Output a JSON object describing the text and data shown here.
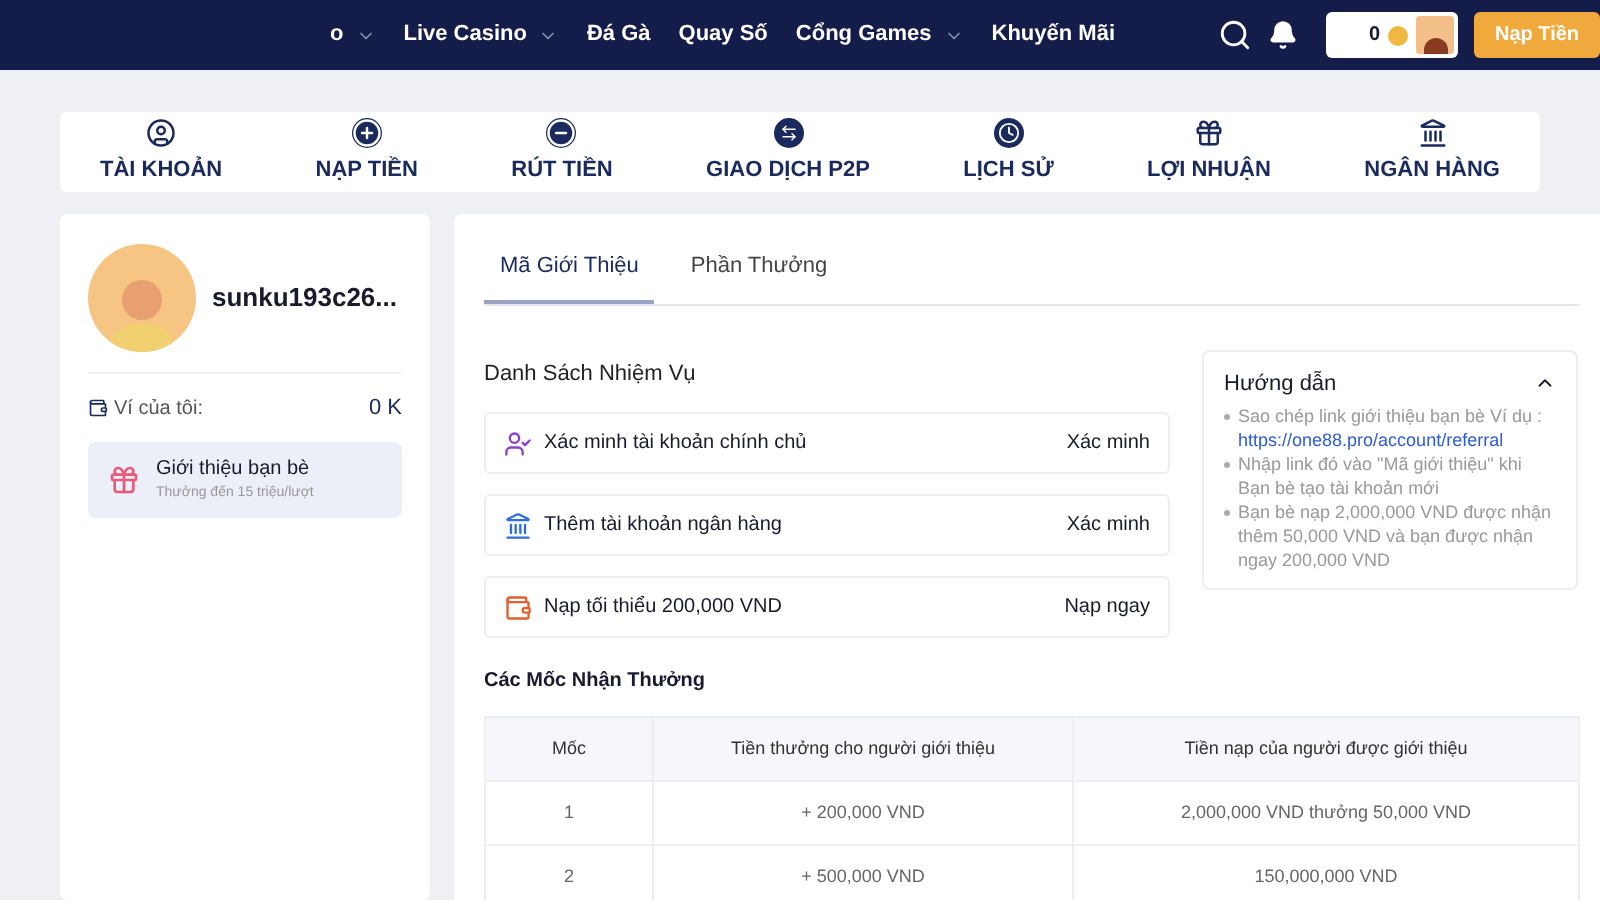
{
  "header": {
    "nav": [
      {
        "label": "o",
        "dropdown": true
      },
      {
        "label": "Live Casino",
        "dropdown": true
      },
      {
        "label": "Đá Gà",
        "dropdown": false
      },
      {
        "label": "Quay Số",
        "dropdown": false
      },
      {
        "label": "Cổng Games",
        "dropdown": true
      },
      {
        "label": "Khuyến Mãi",
        "dropdown": false
      }
    ],
    "balance": "0",
    "deposit_button": "Nạp Tiền"
  },
  "account_nav": [
    {
      "label": "TÀI KHOẢN",
      "kind": "user"
    },
    {
      "label": "NẠP TIỀN",
      "kind": "plus"
    },
    {
      "label": "RÚT TIỀN",
      "kind": "minus"
    },
    {
      "label": "GIAO DỊCH P2P",
      "kind": "swap"
    },
    {
      "label": "LỊCH SỬ",
      "kind": "clock"
    },
    {
      "label": "LỢI NHUẬN",
      "kind": "gift"
    },
    {
      "label": "NGÂN HÀNG",
      "kind": "bank"
    }
  ],
  "profile": {
    "username": "sunku193c26...",
    "wallet_label": "Ví của tôi:",
    "wallet_value": "0 K",
    "referral": {
      "title": "Giới thiệu bạn bè",
      "subtitle": "Thưởng đến 15 triệu/lượt"
    }
  },
  "tabs": [
    {
      "label": "Mã Giới Thiệu",
      "selected": true
    },
    {
      "label": "Phần Thưởng",
      "selected": false
    }
  ],
  "tasks": {
    "title": "Danh Sách Nhiệm Vụ",
    "items": [
      {
        "label": "Xác minh tài khoản chính chủ",
        "action": "Xác minh",
        "kind": "user"
      },
      {
        "label": "Thêm tài khoản ngân hàng",
        "action": "Xác minh",
        "kind": "bank"
      },
      {
        "label": "Nạp tối thiểu 200,000 VND",
        "action": "Nạp ngay",
        "kind": "wallet"
      }
    ]
  },
  "guide": {
    "title": "Hướng dẫn",
    "expanded": true,
    "items": [
      {
        "text": "Sao chép link giới thiệu bạn bè Ví dụ :",
        "link": "https://one88.pro/account/referral"
      },
      {
        "text": "Nhập link đó vào \"Mã giới thiệu\" khi Bạn bè tạo tài khoản mới"
      },
      {
        "text": "Bạn bè nạp 2,000,000 VND được nhận thêm 50,000 VND và bạn được nhận ngay 200,000 VND"
      }
    ]
  },
  "milestones": {
    "title": "Các Mốc Nhận Thưởng",
    "columns": [
      "Mốc",
      "Tiền thưởng cho người giới thiệu",
      "Tiền nạp của người được giới thiệu"
    ],
    "rows": [
      [
        "1",
        "+ 200,000 VND",
        "2,000,000 VND thưởng 50,000 VND"
      ],
      [
        "2",
        "+ 500,000 VND",
        "150,000,000 VND"
      ]
    ]
  }
}
